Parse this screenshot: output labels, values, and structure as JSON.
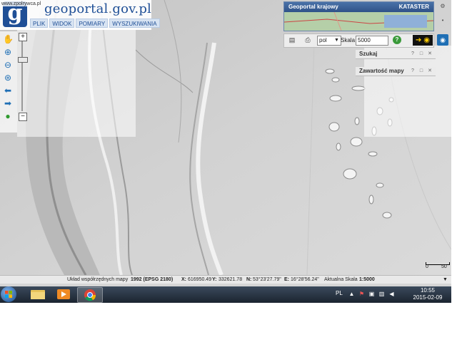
{
  "window": {
    "watermark": "www.zpolrywca.pl",
    "brand_prefix": "geoportal",
    "brand_dot": ".",
    "brand_suffix": "gov.pl",
    "menu": [
      "PLIK",
      "WIDOK",
      "POMIARY",
      "WYSZUKIWANIA"
    ]
  },
  "minimap": {
    "title": "Geoportal krajowy",
    "layer_label": "KATASTER"
  },
  "toolbar": {
    "language": "pol",
    "scale_label": "Skala",
    "scale_value": "5000",
    "help": "?"
  },
  "panels": {
    "search": "Szukaj",
    "map_contents": "Zawartość mapy",
    "controls": [
      "?",
      "□",
      "✕"
    ]
  },
  "scalebar": {
    "start": "0",
    "end": "50"
  },
  "status": {
    "crs_label": "Układ współrzędnych mapy",
    "crs_value": "1992 (EPSG 2180)",
    "x_label": "X:",
    "x_value": "616950.49",
    "y_label": "Y:",
    "y_value": "332621.78",
    "n_label": "N:",
    "n_value": "53°23'27.79\"",
    "e_label": "E:",
    "e_value": "16°28'56.24\"",
    "scale_label": "Aktualna Skala",
    "scale_value": "1:5000"
  },
  "taskbar": {
    "language": "PL",
    "time": "10:55",
    "date": "2015-02-09"
  },
  "colors": {
    "brand": "#1f4f96",
    "map_bg": "#cfcfcf",
    "taskbar": "#1b2430"
  }
}
